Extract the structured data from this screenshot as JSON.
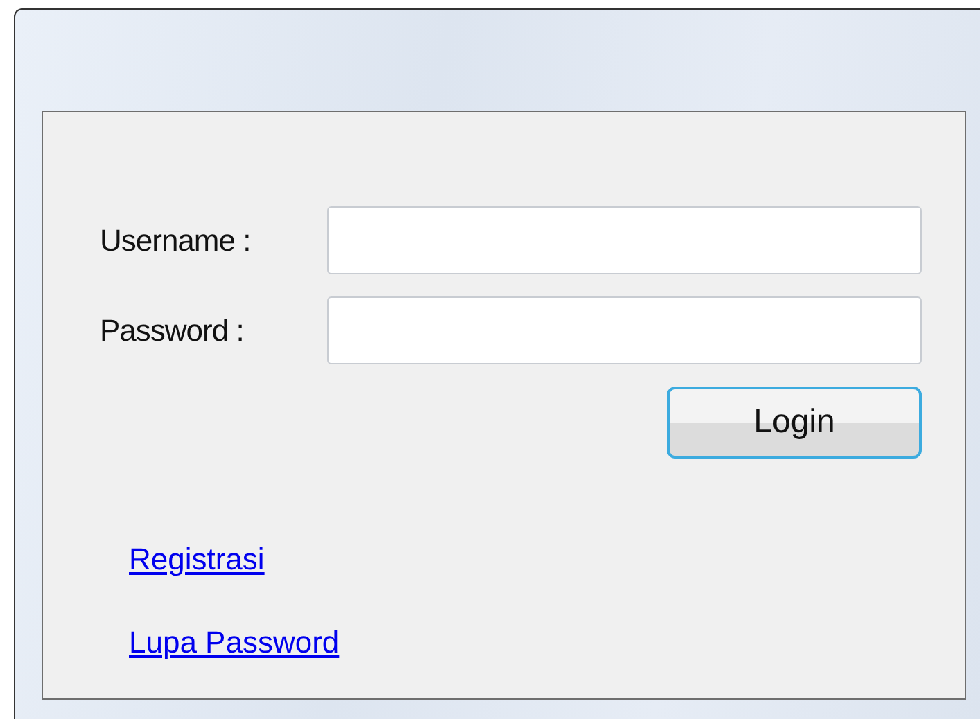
{
  "form": {
    "fields": [
      {
        "label": "Username :"
      },
      {
        "label": "Password :"
      }
    ],
    "button": {
      "label": "Login",
      "focused": true
    },
    "links": [
      "Registrasi",
      "Lupa Password"
    ]
  }
}
